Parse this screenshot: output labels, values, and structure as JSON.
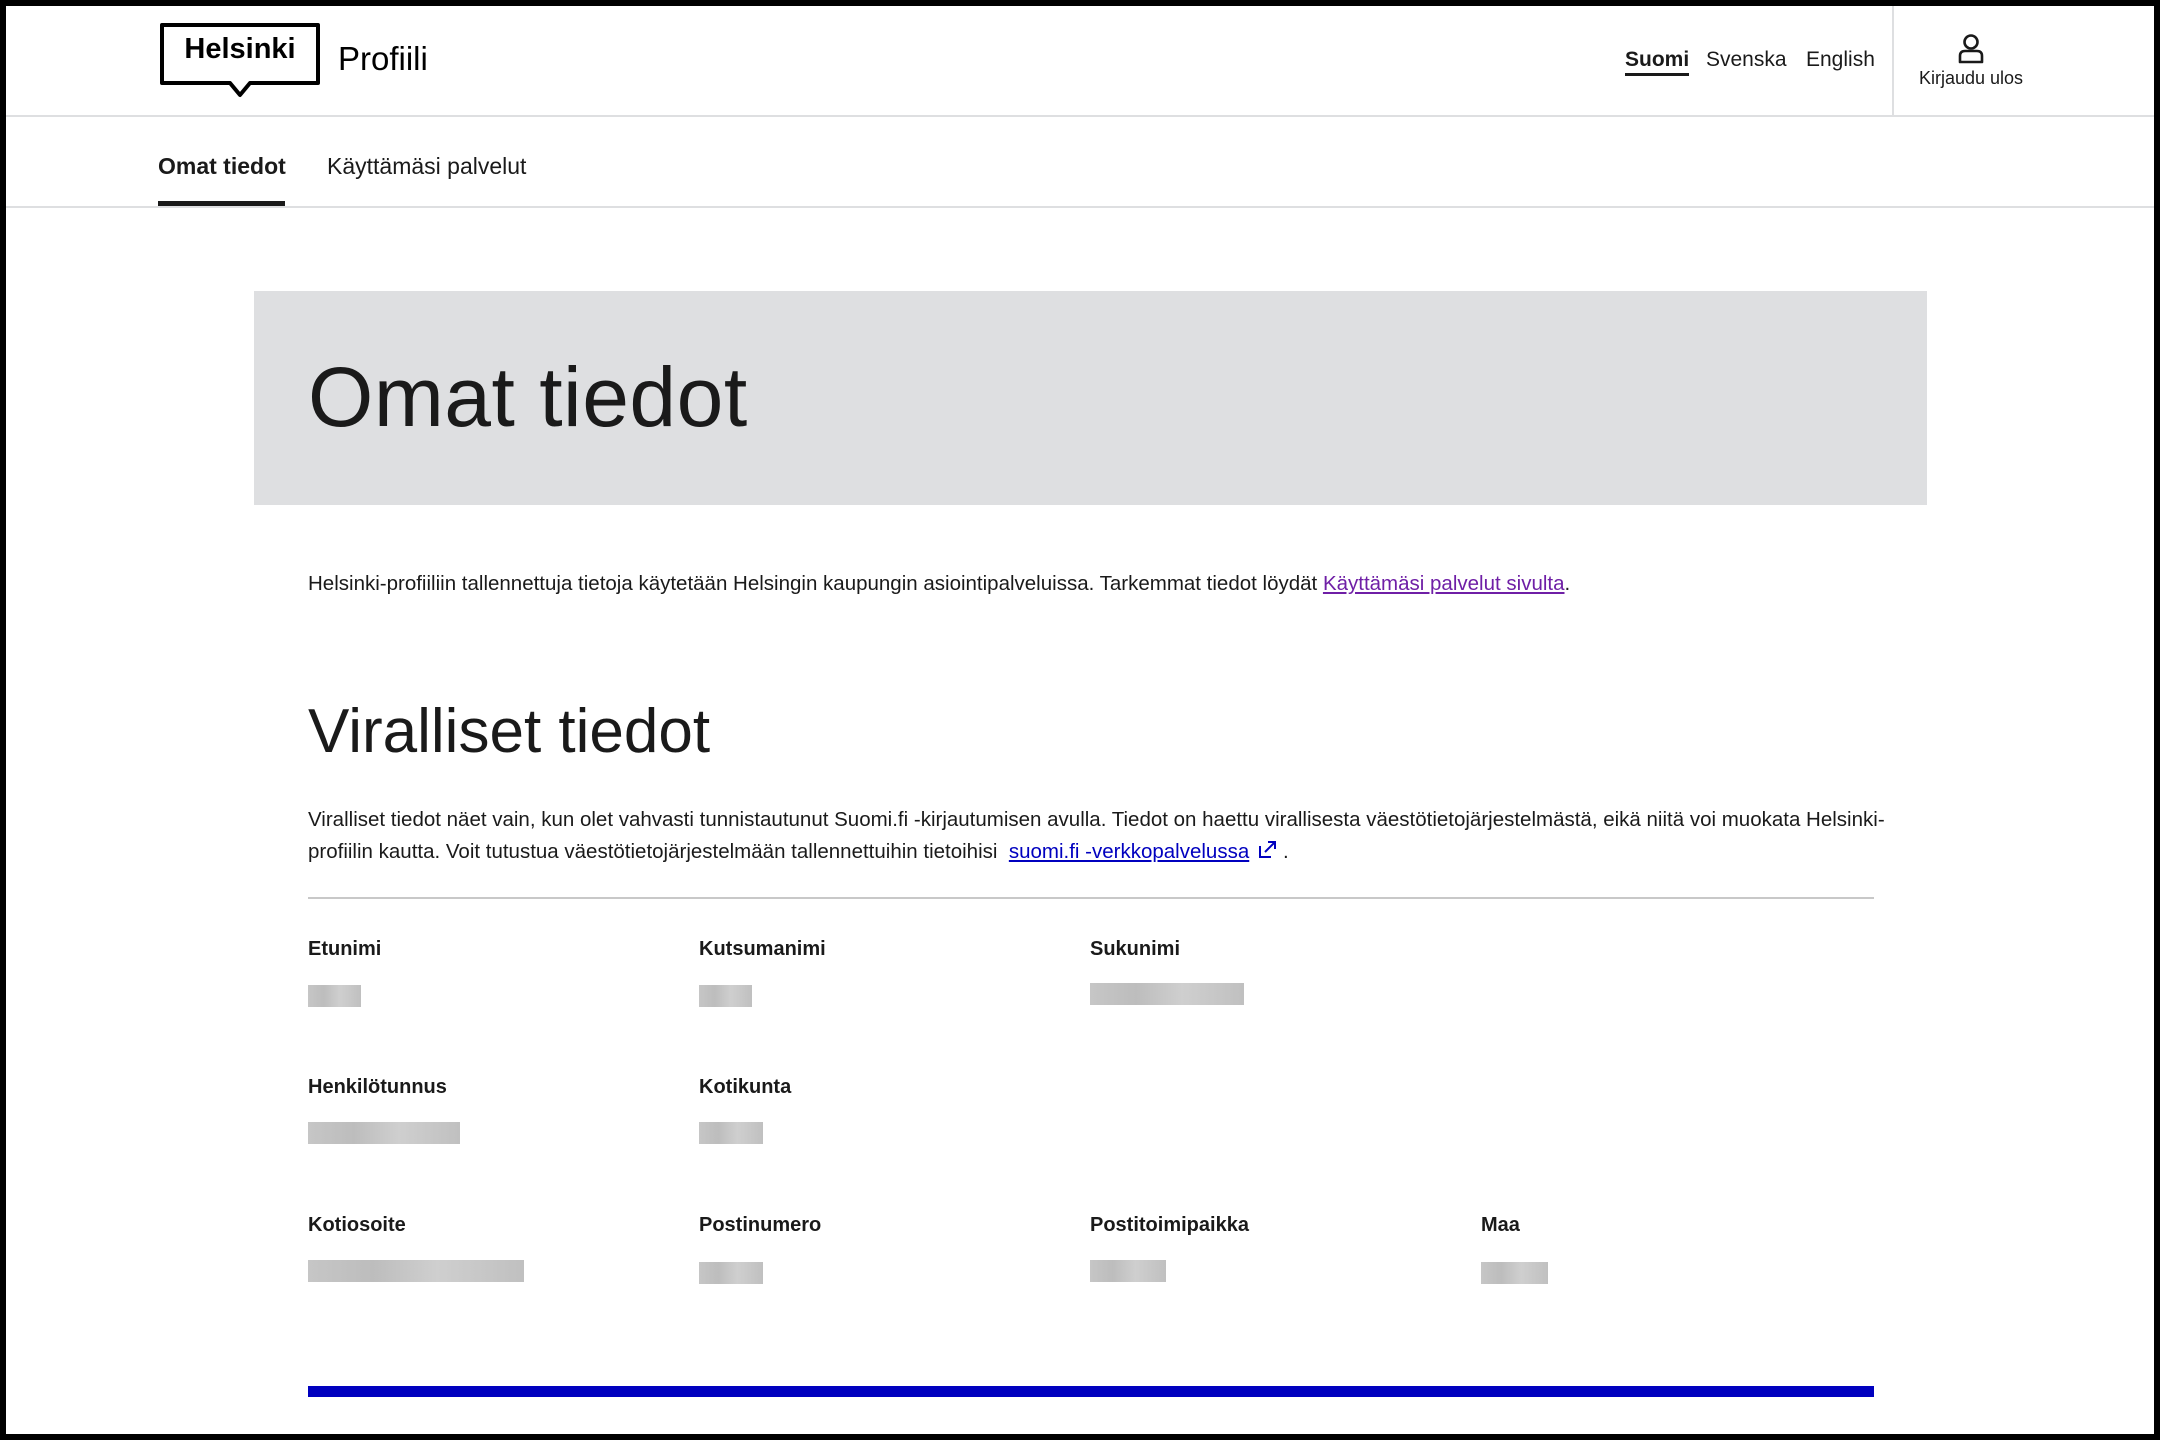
{
  "header": {
    "logo_text": "Helsinki",
    "app_name": "Profiili",
    "languages": [
      {
        "label": "Suomi",
        "active": true
      },
      {
        "label": "Svenska",
        "active": false
      },
      {
        "label": "English",
        "active": false
      }
    ],
    "logout_label": "Kirjaudu ulos",
    "logout_icon": "user-icon"
  },
  "tabs": [
    {
      "label": "Omat tiedot",
      "active": true
    },
    {
      "label": "Käyttämäsi palvelut",
      "active": false
    }
  ],
  "hero": {
    "title": "Omat tiedot"
  },
  "intro": {
    "text": "Helsinki-profiiliin tallennettuja tietoja käytetään Helsingin kaupungin asiointipalveluissa. Tarkemmat tiedot löydät ",
    "link": "Käyttämäsi palvelut sivulta",
    "suffix": "."
  },
  "official": {
    "title": "Viralliset tiedot",
    "description": "Viralliset tiedot näet vain, kun olet vahvasti tunnistautunut Suomi.fi -kirjautumisen avulla. Tiedot on haettu virallisesta väestötietojärjestelmästä, eikä niitä voi muokata Helsinki-profiilin kautta. Voit tutustua väestötietojärjestelmään tallennettuihin tietoihisi",
    "link": "suomi.fi -verkkopalvelussa",
    "link_icon": "external-link-icon",
    "suffix": ".",
    "fields": [
      {
        "label": "Etunimi",
        "value": "redacted"
      },
      {
        "label": "Kutsumanimi",
        "value": "redacted"
      },
      {
        "label": "Sukunimi",
        "value": "redacted"
      },
      {
        "label": "Henkilötunnus",
        "value": "redacted"
      },
      {
        "label": "Kotikunta",
        "value": "redacted"
      },
      {
        "label": "Kotiosoite",
        "value": "redacted"
      },
      {
        "label": "Postinumero",
        "value": "redacted"
      },
      {
        "label": "Postitoimipaikka",
        "value": "redacted"
      },
      {
        "label": "Maa",
        "value": "redacted"
      }
    ]
  },
  "colors": {
    "link_visited": "#6f1fa6",
    "link": "#0000bf",
    "hero_bg": "#dedfe1",
    "accent_bar": "#0000bf"
  }
}
